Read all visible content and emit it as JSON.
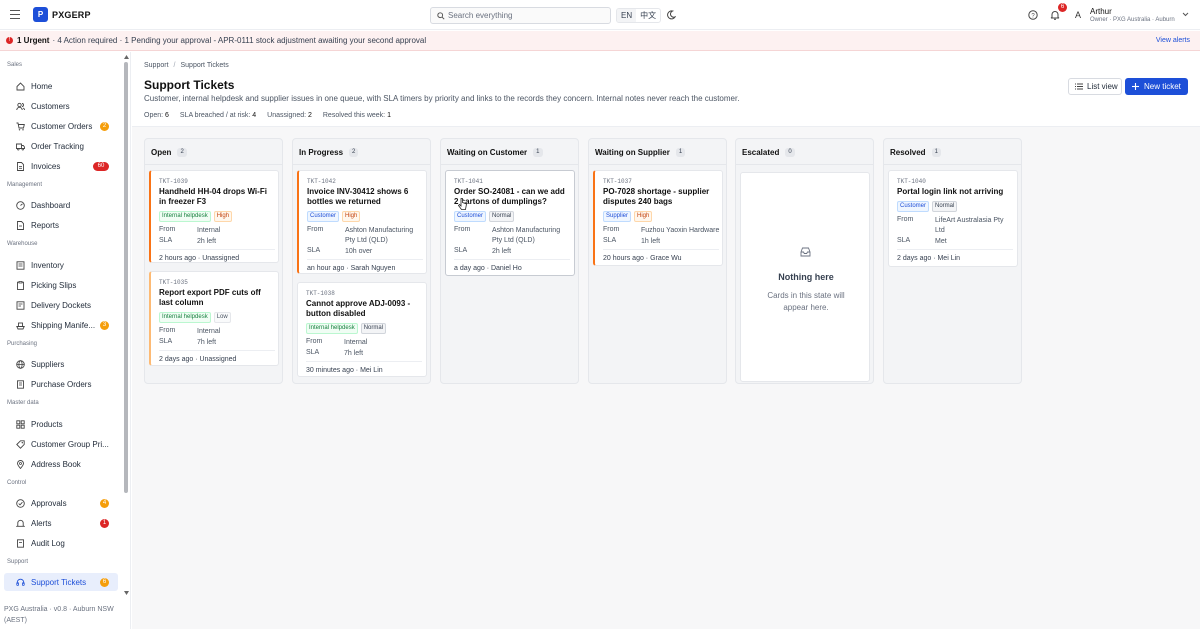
{
  "app": {
    "logo_letter": "P",
    "name": "PXGERP"
  },
  "topbar": {
    "search_placeholder": "Search everything",
    "lang_en": "EN",
    "lang_zh": "中文",
    "notifications_count": "6",
    "user_initial": "A",
    "user_name": "Arthur",
    "user_role": "Owner · PXG Australia · Auburn"
  },
  "alert": {
    "icon": "!",
    "urgent": "1 Urgent",
    "text": "· 4 Action required · 1 Pending your approval - APR-0111 stock adjustment awaiting your second approval",
    "link": "View alerts"
  },
  "sidebar": {
    "sections": {
      "sales": "Sales",
      "management": "Management",
      "warehouse": "Warehouse",
      "purchasing": "Purchasing",
      "master": "Master data",
      "control": "Control",
      "support": "Support"
    },
    "items": {
      "home": "Home",
      "customers": "Customers",
      "customer_orders": "Customer Orders",
      "order_tracking": "Order Tracking",
      "invoices": "Invoices",
      "dashboard": "Dashboard",
      "reports": "Reports",
      "inventory": "Inventory",
      "picking_slips": "Picking Slips",
      "delivery_dockets": "Delivery Dockets",
      "shipping": "Shipping Manife...",
      "suppliers": "Suppliers",
      "purchase_orders": "Purchase Orders",
      "products": "Products",
      "customer_group": "Customer Group Pri...",
      "address_book": "Address Book",
      "approvals": "Approvals",
      "alerts": "Alerts",
      "audit_log": "Audit Log",
      "support_tickets": "Support Tickets"
    },
    "badges": {
      "customer_orders": "2",
      "invoices": "60",
      "shipping": "3",
      "approvals": "4",
      "alerts": "1",
      "support_tickets": "6"
    },
    "footer": "PXG Australia · v0.8 · Auburn NSW (AEST)"
  },
  "page": {
    "breadcrumb_root": "Support",
    "breadcrumb_current": "Support Tickets",
    "title": "Support Tickets",
    "description": "Customer, internal helpdesk and supplier issues in one queue, with SLA timers by priority and links to the records they concern. Internal notes never reach the customer.",
    "stats": {
      "open_label": "Open:",
      "open": "6",
      "sla_label": "SLA breached / at risk:",
      "sla": "4",
      "unassigned_label": "Unassigned:",
      "unassigned": "2",
      "resolved_label": "Resolved this week:",
      "resolved": "1"
    },
    "list_view": "List view",
    "new_ticket": "New ticket"
  },
  "board": {
    "from_label": "From",
    "sla_label": "SLA",
    "columns": [
      {
        "name": "Open",
        "count": "2",
        "cards": [
          {
            "id": "TKT-1039",
            "title": "Handheld HH-04 drops Wi-Fi in freezer F3",
            "type": "Internal helpdesk",
            "priority": "High",
            "from": "Internal",
            "sla": "2h left",
            "footer": "2 hours ago · Unassigned"
          },
          {
            "id": "TKT-1035",
            "title": "Report export PDF cuts off last column",
            "type": "Internal helpdesk",
            "priority": "Low",
            "from": "Internal",
            "sla": "7h left",
            "footer": "2 days ago · Unassigned"
          }
        ]
      },
      {
        "name": "In Progress",
        "count": "2",
        "cards": [
          {
            "id": "TKT-1042",
            "title": "Invoice INV-30412 shows 6 bottles we returned",
            "type": "Customer",
            "priority": "High",
            "from": "Ashton Manufacturing Pty Ltd (QLD)",
            "sla": "10h over",
            "footer": "an hour ago · Sarah Nguyen"
          },
          {
            "id": "TKT-1038",
            "title": "Cannot approve ADJ-0093 - button disabled",
            "type": "Internal helpdesk",
            "priority": "Normal",
            "from": "Internal",
            "sla": "7h left",
            "footer": "30 minutes ago · Mei Lin"
          }
        ]
      },
      {
        "name": "Waiting on Customer",
        "count": "1",
        "cards": [
          {
            "id": "TKT-1041",
            "title": "Order SO-24081 - can we add 2 cartons of dumplings?",
            "type": "Customer",
            "priority": "Normal",
            "from": "Ashton Manufacturing Pty Ltd (QLD)",
            "sla": "2h left",
            "footer": "a day ago · Daniel Ho"
          }
        ]
      },
      {
        "name": "Waiting on Supplier",
        "count": "1",
        "cards": [
          {
            "id": "TKT-1037",
            "title": "PO-7028 shortage - supplier disputes 240 bags",
            "type": "Supplier",
            "priority": "High",
            "from": "Fuzhou Yaoxin Hardware",
            "sla": "1h left",
            "footer": "20 hours ago · Grace Wu"
          }
        ]
      },
      {
        "name": "Escalated",
        "count": "0",
        "empty_title": "Nothing here",
        "empty_text": "Cards in this state will appear here."
      },
      {
        "name": "Resolved",
        "count": "1",
        "cards": [
          {
            "id": "TKT-1040",
            "title": "Portal login link not arriving",
            "type": "Customer",
            "priority": "Normal",
            "from": "LifeArt Australasia Pty Ltd",
            "sla": "Met",
            "footer": "2 days ago · Mei Lin"
          }
        ]
      }
    ]
  }
}
